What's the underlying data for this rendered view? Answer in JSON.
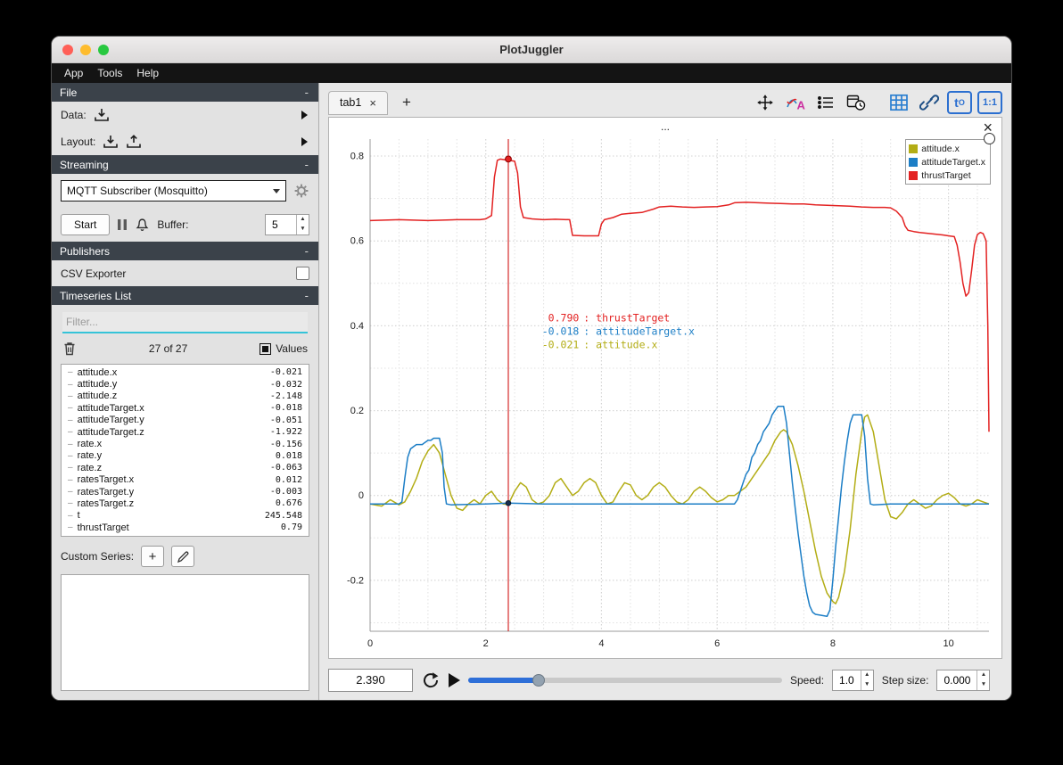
{
  "window": {
    "title": "PlotJuggler"
  },
  "menu": {
    "items": [
      "App",
      "Tools",
      "Help"
    ]
  },
  "sidebar": {
    "file": {
      "title": "File",
      "collapse": "-",
      "data_label": "Data:",
      "layout_label": "Layout:"
    },
    "streaming": {
      "title": "Streaming",
      "collapse": "-",
      "source_selected": "MQTT Subscriber (Mosquitto)",
      "start_label": "Start",
      "buffer_label": "Buffer:",
      "buffer_value": "5"
    },
    "publishers": {
      "title": "Publishers",
      "collapse": "-",
      "csv_exporter_label": "CSV Exporter"
    },
    "timeseries": {
      "title": "Timeseries List",
      "collapse": "-",
      "filter_placeholder": "Filter...",
      "count_label": "27 of 27",
      "values_label": "Values",
      "items": [
        {
          "name": "attitude.x",
          "value": "-0.021"
        },
        {
          "name": "attitude.y",
          "value": "-0.032"
        },
        {
          "name": "attitude.z",
          "value": "-2.148"
        },
        {
          "name": "attitudeTarget.x",
          "value": "-0.018"
        },
        {
          "name": "attitudeTarget.y",
          "value": "-0.051"
        },
        {
          "name": "attitudeTarget.z",
          "value": "-1.922"
        },
        {
          "name": "rate.x",
          "value": "-0.156"
        },
        {
          "name": "rate.y",
          "value": "0.018"
        },
        {
          "name": "rate.z",
          "value": "-0.063"
        },
        {
          "name": "ratesTarget.x",
          "value": "0.012"
        },
        {
          "name": "ratesTarget.y",
          "value": "-0.003"
        },
        {
          "name": "ratesTarget.z",
          "value": "0.676"
        },
        {
          "name": "t",
          "value": "245.548"
        },
        {
          "name": "thrustTarget",
          "value": "0.79"
        }
      ]
    },
    "custom_series_label": "Custom Series:",
    "custom_add_label": "+"
  },
  "main": {
    "tab_label": "tab1",
    "tab_close": "×",
    "add_tab_label": "+",
    "plot_title": "...",
    "plot_close": "×",
    "t0_main": "t",
    "t0_sub": "O",
    "ratio_label": "1:1"
  },
  "chart_data": {
    "type": "line",
    "title": "...",
    "xlabel": "",
    "ylabel": "",
    "xlim": [
      0,
      10.7
    ],
    "ylim": [
      -0.32,
      0.84
    ],
    "x_ticks": [
      0,
      2,
      4,
      6,
      8,
      10
    ],
    "y_ticks": [
      -0.2,
      0,
      0.2,
      0.4,
      0.6,
      0.8
    ],
    "grid": true,
    "legend_position": "top-right",
    "tracker": {
      "x": 2.39,
      "label_x": 3.69,
      "label_y": 0.41,
      "top_dot_y": 0.793,
      "bottom_dot_y": -0.018,
      "lines": [
        {
          "value": "0.790",
          "series": "thrustTarget"
        },
        {
          "value": "-0.018",
          "series": "attitudeTarget.x"
        },
        {
          "value": "-0.021",
          "series": "attitude.x"
        }
      ]
    },
    "series": [
      {
        "name": "attitude.x",
        "color": "#b3ad15",
        "points": [
          [
            0,
            -0.02
          ],
          [
            0.2,
            -0.025
          ],
          [
            0.35,
            -0.01
          ],
          [
            0.5,
            -0.022
          ],
          [
            0.6,
            -0.015
          ],
          [
            0.7,
            0.01
          ],
          [
            0.8,
            0.04
          ],
          [
            0.9,
            0.08
          ],
          [
            1.0,
            0.105
          ],
          [
            1.1,
            0.12
          ],
          [
            1.2,
            0.1
          ],
          [
            1.3,
            0.05
          ],
          [
            1.4,
            0.0
          ],
          [
            1.5,
            -0.03
          ],
          [
            1.6,
            -0.035
          ],
          [
            1.7,
            -0.02
          ],
          [
            1.8,
            -0.01
          ],
          [
            1.9,
            -0.02
          ],
          [
            2.0,
            0.0
          ],
          [
            2.1,
            0.01
          ],
          [
            2.2,
            -0.01
          ],
          [
            2.3,
            -0.02
          ],
          [
            2.39,
            -0.021
          ],
          [
            2.5,
            0.01
          ],
          [
            2.6,
            0.03
          ],
          [
            2.7,
            0.02
          ],
          [
            2.8,
            -0.01
          ],
          [
            2.9,
            -0.02
          ],
          [
            3.0,
            -0.015
          ],
          [
            3.1,
            0.0
          ],
          [
            3.2,
            0.03
          ],
          [
            3.3,
            0.04
          ],
          [
            3.4,
            0.02
          ],
          [
            3.5,
            0.0
          ],
          [
            3.6,
            0.01
          ],
          [
            3.7,
            0.03
          ],
          [
            3.8,
            0.04
          ],
          [
            3.9,
            0.03
          ],
          [
            4.0,
            0.0
          ],
          [
            4.1,
            -0.02
          ],
          [
            4.2,
            -0.015
          ],
          [
            4.3,
            0.01
          ],
          [
            4.4,
            0.03
          ],
          [
            4.5,
            0.025
          ],
          [
            4.6,
            0.0
          ],
          [
            4.7,
            -0.01
          ],
          [
            4.8,
            0.0
          ],
          [
            4.9,
            0.02
          ],
          [
            5.0,
            0.03
          ],
          [
            5.1,
            0.02
          ],
          [
            5.2,
            0.0
          ],
          [
            5.3,
            -0.015
          ],
          [
            5.4,
            -0.02
          ],
          [
            5.5,
            -0.01
          ],
          [
            5.6,
            0.01
          ],
          [
            5.7,
            0.02
          ],
          [
            5.8,
            0.01
          ],
          [
            5.9,
            -0.005
          ],
          [
            6.0,
            -0.015
          ],
          [
            6.1,
            -0.01
          ],
          [
            6.2,
            0.0
          ],
          [
            6.3,
            0.0
          ],
          [
            6.4,
            0.01
          ],
          [
            6.5,
            0.02
          ],
          [
            6.6,
            0.04
          ],
          [
            6.7,
            0.06
          ],
          [
            6.8,
            0.08
          ],
          [
            6.9,
            0.1
          ],
          [
            7.0,
            0.13
          ],
          [
            7.1,
            0.15
          ],
          [
            7.15,
            0.155
          ],
          [
            7.2,
            0.15
          ],
          [
            7.3,
            0.12
          ],
          [
            7.4,
            0.07
          ],
          [
            7.5,
            0.01
          ],
          [
            7.6,
            -0.06
          ],
          [
            7.7,
            -0.13
          ],
          [
            7.8,
            -0.19
          ],
          [
            7.9,
            -0.23
          ],
          [
            8.0,
            -0.25
          ],
          [
            8.05,
            -0.255
          ],
          [
            8.1,
            -0.24
          ],
          [
            8.2,
            -0.18
          ],
          [
            8.3,
            -0.08
          ],
          [
            8.4,
            0.05
          ],
          [
            8.5,
            0.15
          ],
          [
            8.55,
            0.185
          ],
          [
            8.6,
            0.19
          ],
          [
            8.7,
            0.15
          ],
          [
            8.8,
            0.07
          ],
          [
            8.9,
            -0.01
          ],
          [
            9.0,
            -0.05
          ],
          [
            9.1,
            -0.055
          ],
          [
            9.2,
            -0.04
          ],
          [
            9.3,
            -0.02
          ],
          [
            9.4,
            -0.01
          ],
          [
            9.5,
            -0.02
          ],
          [
            9.6,
            -0.03
          ],
          [
            9.7,
            -0.025
          ],
          [
            9.8,
            -0.01
          ],
          [
            9.9,
            0.0
          ],
          [
            10.0,
            0.005
          ],
          [
            10.1,
            -0.005
          ],
          [
            10.2,
            -0.02
          ],
          [
            10.3,
            -0.025
          ],
          [
            10.4,
            -0.02
          ],
          [
            10.5,
            -0.01
          ],
          [
            10.6,
            -0.015
          ],
          [
            10.7,
            -0.02
          ]
        ]
      },
      {
        "name": "attitudeTarget.x",
        "color": "#1c7ec6",
        "points": [
          [
            0,
            -0.02
          ],
          [
            0.5,
            -0.02
          ],
          [
            0.55,
            -0.015
          ],
          [
            0.6,
            0.04
          ],
          [
            0.62,
            0.06
          ],
          [
            0.65,
            0.09
          ],
          [
            0.7,
            0.11
          ],
          [
            0.75,
            0.115
          ],
          [
            0.8,
            0.12
          ],
          [
            0.9,
            0.12
          ],
          [
            0.95,
            0.125
          ],
          [
            1.0,
            0.13
          ],
          [
            1.05,
            0.13
          ],
          [
            1.1,
            0.135
          ],
          [
            1.2,
            0.135
          ],
          [
            1.25,
            0.1
          ],
          [
            1.28,
            0.02
          ],
          [
            1.32,
            -0.02
          ],
          [
            1.4,
            -0.022
          ],
          [
            2.0,
            -0.02
          ],
          [
            2.39,
            -0.018
          ],
          [
            3.0,
            -0.02
          ],
          [
            4.0,
            -0.02
          ],
          [
            5.0,
            -0.02
          ],
          [
            6.0,
            -0.02
          ],
          [
            6.3,
            -0.02
          ],
          [
            6.35,
            -0.01
          ],
          [
            6.4,
            0.01
          ],
          [
            6.45,
            0.03
          ],
          [
            6.5,
            0.05
          ],
          [
            6.55,
            0.06
          ],
          [
            6.6,
            0.09
          ],
          [
            6.65,
            0.1
          ],
          [
            6.7,
            0.12
          ],
          [
            6.75,
            0.13
          ],
          [
            6.8,
            0.15
          ],
          [
            6.85,
            0.16
          ],
          [
            6.9,
            0.17
          ],
          [
            6.95,
            0.19
          ],
          [
            7.0,
            0.2
          ],
          [
            7.05,
            0.21
          ],
          [
            7.15,
            0.21
          ],
          [
            7.2,
            0.17
          ],
          [
            7.25,
            0.1
          ],
          [
            7.3,
            0.03
          ],
          [
            7.35,
            -0.03
          ],
          [
            7.4,
            -0.09
          ],
          [
            7.45,
            -0.14
          ],
          [
            7.5,
            -0.19
          ],
          [
            7.55,
            -0.23
          ],
          [
            7.6,
            -0.26
          ],
          [
            7.65,
            -0.275
          ],
          [
            7.7,
            -0.28
          ],
          [
            7.9,
            -0.285
          ],
          [
            7.95,
            -0.27
          ],
          [
            8.0,
            -0.2
          ],
          [
            8.05,
            -0.12
          ],
          [
            8.1,
            -0.05
          ],
          [
            8.15,
            0.02
          ],
          [
            8.2,
            0.08
          ],
          [
            8.25,
            0.13
          ],
          [
            8.3,
            0.17
          ],
          [
            8.35,
            0.19
          ],
          [
            8.5,
            0.19
          ],
          [
            8.55,
            0.14
          ],
          [
            8.6,
            0.04
          ],
          [
            8.65,
            -0.02
          ],
          [
            8.7,
            -0.022
          ],
          [
            9.0,
            -0.02
          ],
          [
            9.5,
            -0.02
          ],
          [
            10.0,
            -0.02
          ],
          [
            10.7,
            -0.02
          ]
        ]
      },
      {
        "name": "thrustTarget",
        "color": "#e32222",
        "points": [
          [
            0,
            0.648
          ],
          [
            0.5,
            0.65
          ],
          [
            1.0,
            0.648
          ],
          [
            1.5,
            0.65
          ],
          [
            1.9,
            0.65
          ],
          [
            2.0,
            0.652
          ],
          [
            2.1,
            0.66
          ],
          [
            2.15,
            0.75
          ],
          [
            2.2,
            0.79
          ],
          [
            2.25,
            0.793
          ],
          [
            2.39,
            0.79
          ],
          [
            2.5,
            0.788
          ],
          [
            2.55,
            0.76
          ],
          [
            2.6,
            0.68
          ],
          [
            2.65,
            0.655
          ],
          [
            2.8,
            0.652
          ],
          [
            3.0,
            0.65
          ],
          [
            3.2,
            0.651
          ],
          [
            3.45,
            0.65
          ],
          [
            3.5,
            0.613
          ],
          [
            3.7,
            0.612
          ],
          [
            3.95,
            0.612
          ],
          [
            4.0,
            0.64
          ],
          [
            4.05,
            0.65
          ],
          [
            4.2,
            0.655
          ],
          [
            4.35,
            0.663
          ],
          [
            4.5,
            0.665
          ],
          [
            4.7,
            0.667
          ],
          [
            4.9,
            0.675
          ],
          [
            5.0,
            0.68
          ],
          [
            5.2,
            0.682
          ],
          [
            5.4,
            0.68
          ],
          [
            5.6,
            0.679
          ],
          [
            5.8,
            0.68
          ],
          [
            6.0,
            0.681
          ],
          [
            6.2,
            0.685
          ],
          [
            6.3,
            0.69
          ],
          [
            6.5,
            0.691
          ],
          [
            6.7,
            0.69
          ],
          [
            6.9,
            0.689
          ],
          [
            7.1,
            0.688
          ],
          [
            7.3,
            0.687
          ],
          [
            7.5,
            0.687
          ],
          [
            7.7,
            0.685
          ],
          [
            7.9,
            0.684
          ],
          [
            8.1,
            0.683
          ],
          [
            8.3,
            0.682
          ],
          [
            8.5,
            0.68
          ],
          [
            8.7,
            0.679
          ],
          [
            8.9,
            0.679
          ],
          [
            9.0,
            0.678
          ],
          [
            9.1,
            0.67
          ],
          [
            9.2,
            0.655
          ],
          [
            9.25,
            0.635
          ],
          [
            9.3,
            0.625
          ],
          [
            9.4,
            0.622
          ],
          [
            9.5,
            0.62
          ],
          [
            9.7,
            0.617
          ],
          [
            9.9,
            0.614
          ],
          [
            10.0,
            0.612
          ],
          [
            10.1,
            0.61
          ],
          [
            10.15,
            0.59
          ],
          [
            10.2,
            0.55
          ],
          [
            10.25,
            0.5
          ],
          [
            10.3,
            0.47
          ],
          [
            10.35,
            0.478
          ],
          [
            10.4,
            0.53
          ],
          [
            10.45,
            0.59
          ],
          [
            10.5,
            0.615
          ],
          [
            10.55,
            0.62
          ],
          [
            10.6,
            0.617
          ],
          [
            10.65,
            0.6
          ],
          [
            10.68,
            0.4
          ],
          [
            10.7,
            0.15
          ]
        ]
      }
    ]
  },
  "playback": {
    "time_value": "2.390",
    "slider_fraction": 0.225,
    "speed_label": "Speed:",
    "speed_value": "1.0",
    "step_label": "Step size:",
    "step_value": "0.000"
  }
}
